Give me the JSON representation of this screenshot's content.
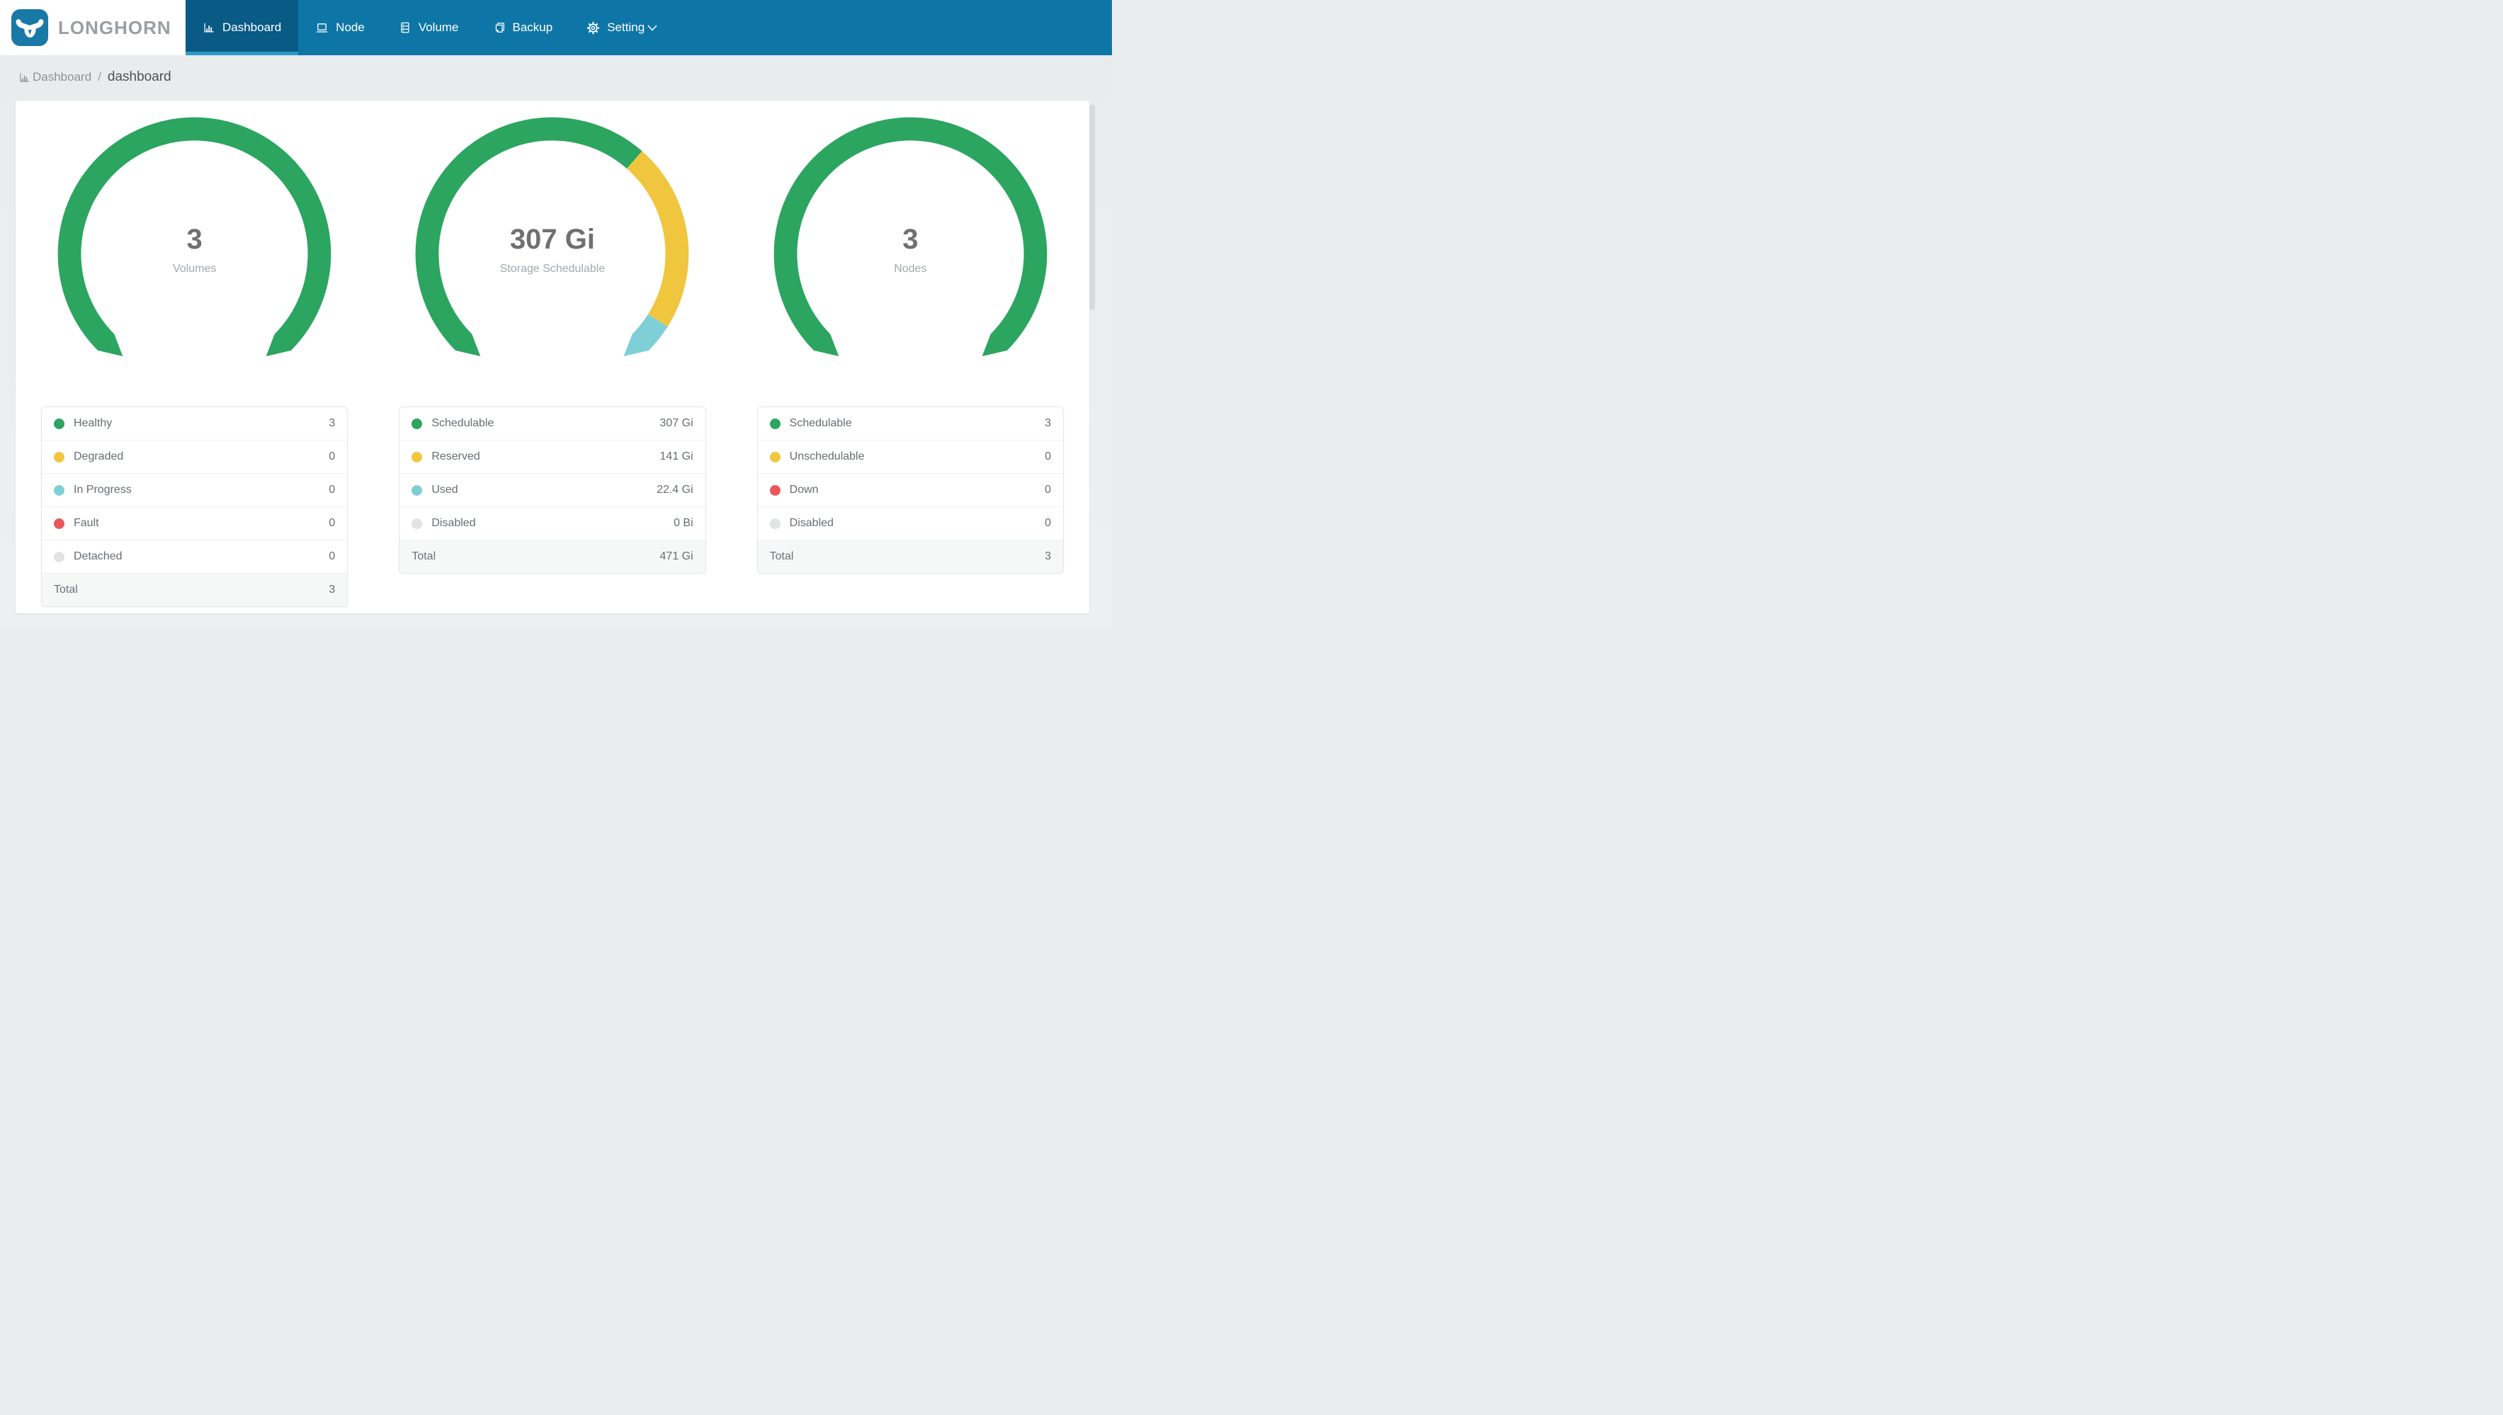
{
  "colors": {
    "navbar": "#0E76A6",
    "nav_active_bg": "#0A5A86",
    "nav_active_underline": "#2E9BC6",
    "logo_blue": "#1879A6",
    "brand_text": "#9A9FA1",
    "green": "#2BA55F",
    "yellow": "#F0C63E",
    "teal": "#7FD0D6",
    "red": "#EA575B",
    "gray": "#E1E3E4",
    "page_background": "#EAEDEE"
  },
  "brand": {
    "name": "LONGHORN",
    "logo_icon": "longhorn-bull-icon"
  },
  "nav": {
    "items": [
      {
        "id": "dashboard",
        "label": "Dashboard",
        "icon": "bar-chart",
        "active": true,
        "has_caret": false
      },
      {
        "id": "node",
        "label": "Node",
        "icon": "laptop",
        "active": false,
        "has_caret": false
      },
      {
        "id": "volume",
        "label": "Volume",
        "icon": "database",
        "active": false,
        "has_caret": false
      },
      {
        "id": "backup",
        "label": "Backup",
        "icon": "copy",
        "active": false,
        "has_caret": false
      },
      {
        "id": "setting",
        "label": "Setting",
        "icon": "gear",
        "active": false,
        "has_caret": true
      }
    ]
  },
  "breadcrumb": {
    "icon": "bar-chart",
    "section": "Dashboard",
    "separator": "/",
    "page": "dashboard"
  },
  "chart_data": [
    {
      "type": "donut",
      "title": "Volumes",
      "center_value": "3",
      "center_label": "Volumes",
      "arc_span_degrees": 270,
      "legend_position": "below",
      "segments": [
        {
          "label": "Healthy",
          "value": 3,
          "display": "3",
          "color": "#2BA55F"
        },
        {
          "label": "Degraded",
          "value": 0,
          "display": "0",
          "color": "#F0C63E"
        },
        {
          "label": "In Progress",
          "value": 0,
          "display": "0",
          "color": "#7FD0D6"
        },
        {
          "label": "Fault",
          "value": 0,
          "display": "0",
          "color": "#EA575B"
        },
        {
          "label": "Detached",
          "value": 0,
          "display": "0",
          "color": "#E1E3E4"
        }
      ],
      "total": {
        "label": "Total",
        "value": 3,
        "display": "3"
      }
    },
    {
      "type": "donut",
      "title": "Storage Schedulable",
      "center_value": "307 Gi",
      "center_label": "Storage Schedulable",
      "arc_span_degrees": 270,
      "legend_position": "below",
      "segments": [
        {
          "label": "Schedulable",
          "value": 307,
          "display": "307 Gi",
          "color": "#2BA55F"
        },
        {
          "label": "Reserved",
          "value": 141,
          "display": "141 Gi",
          "color": "#F0C63E"
        },
        {
          "label": "Used",
          "value": 22.4,
          "display": "22.4 Gi",
          "color": "#7FD0D6"
        },
        {
          "label": "Disabled",
          "value": 0,
          "display": "0 Bi",
          "color": "#E1E3E4"
        }
      ],
      "total": {
        "label": "Total",
        "value": 471,
        "display": "471 Gi"
      }
    },
    {
      "type": "donut",
      "title": "Nodes",
      "center_value": "3",
      "center_label": "Nodes",
      "arc_span_degrees": 270,
      "legend_position": "below",
      "segments": [
        {
          "label": "Schedulable",
          "value": 3,
          "display": "3",
          "color": "#2BA55F"
        },
        {
          "label": "Unschedulable",
          "value": 0,
          "display": "0",
          "color": "#F0C63E"
        },
        {
          "label": "Down",
          "value": 0,
          "display": "0",
          "color": "#EA575B"
        },
        {
          "label": "Disabled",
          "value": 0,
          "display": "0",
          "color": "#E1E3E4"
        }
      ],
      "total": {
        "label": "Total",
        "value": 3,
        "display": "3"
      }
    }
  ]
}
